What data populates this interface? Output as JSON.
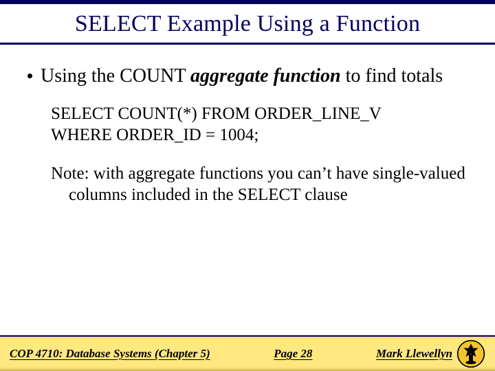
{
  "title": "SELECT Example Using a Function",
  "bullet_pre": "Using the COUNT ",
  "bullet_em": "aggregate function",
  "bullet_post": " to find totals",
  "sql_line1": "SELECT COUNT(*) FROM ORDER_LINE_V",
  "sql_line2": "WHERE ORDER_ID = 1004;",
  "note": "Note: with aggregate functions you can’t have single-valued columns included in the SELECT clause",
  "footer": {
    "course": "COP 4710: Database Systems  (Chapter 5)",
    "page": "Page 28",
    "author": "Mark Llewellyn"
  }
}
